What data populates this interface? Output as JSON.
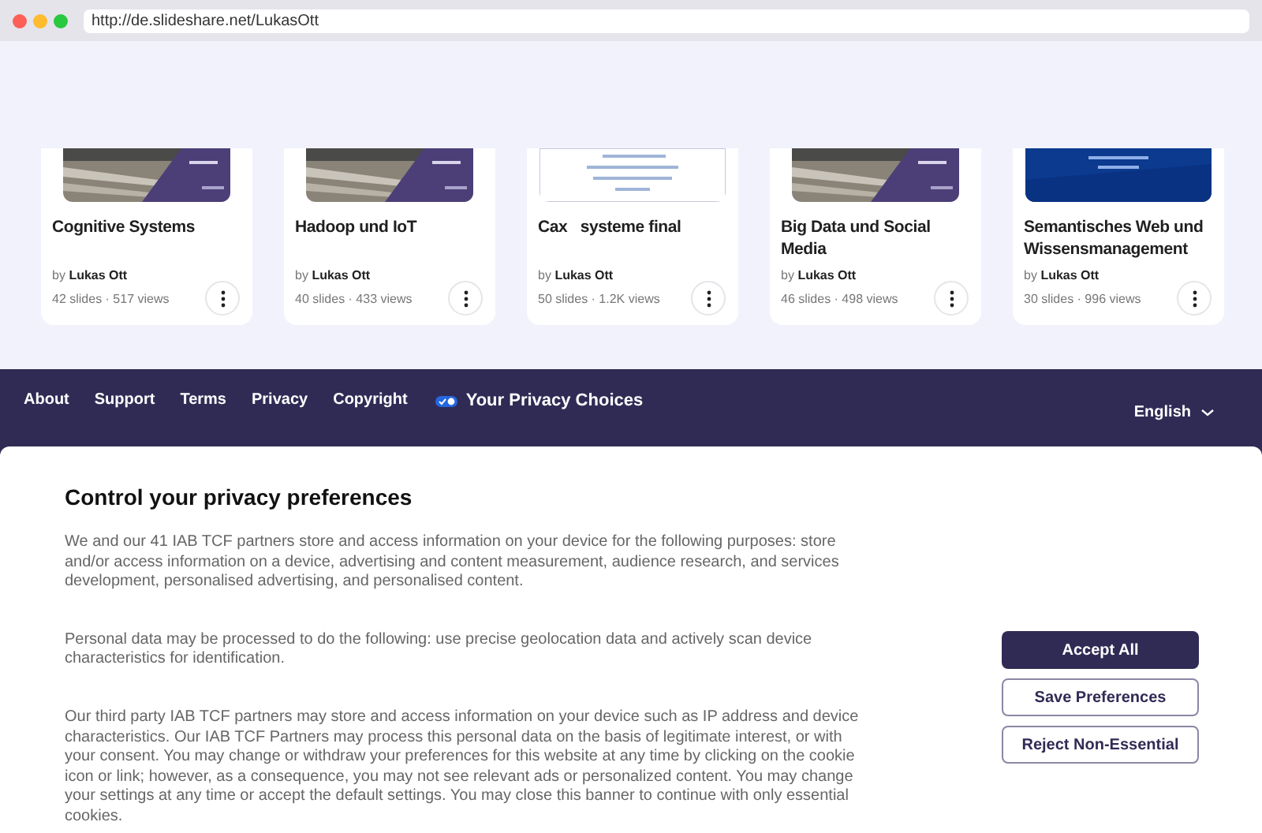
{
  "browser": {
    "url": "http://de.slideshare.net/LukasOtt"
  },
  "cards": [
    {
      "title": "Cognitive Systems",
      "by": "by",
      "author": "Lukas Ott",
      "stats": "42 slides · 517 views"
    },
    {
      "title": "Hadoop und IoT",
      "by": "by",
      "author": "Lukas Ott",
      "stats": "40 slides · 433 views"
    },
    {
      "kind": "document",
      "title": "Cax   systeme final",
      "by": "by",
      "author": "Lukas Ott",
      "stats": "50 slides · 1.2K views"
    },
    {
      "title": "Big Data und Social Media",
      "by": "by",
      "author": "Lukas Ott",
      "stats": "46 slides · 498 views"
    },
    {
      "kind": "blue",
      "title": "Semantisches Web und Wissensmanagement",
      "by": "by",
      "author": "Lukas Ott",
      "stats": "30 slides · 996 views"
    }
  ],
  "footer": {
    "links": [
      "About",
      "Support",
      "Terms",
      "Privacy",
      "Copyright"
    ],
    "privacy_choices": "Your Privacy Choices",
    "language": "English"
  },
  "consent": {
    "title": "Control your privacy preferences",
    "paragraphs": [
      "We and our 41 IAB TCF partners store and access information on your device for the following purposes: store and/or access information on a device, advertising and content measurement, audience research, and services development, personalised advertising, and personalised content.",
      "Personal data may be processed to do the following: use precise geolocation data and actively scan device characteristics for identification.",
      "Our third party IAB TCF partners may store and access information on your device such as IP address and device characteristics. Our IAB TCF Partners may process this personal data on the basis of legitimate interest, or with your consent. You may change or withdraw your preferences for this website at any time by clicking on the cookie icon or link; however, as a consequence, you may not see relevant ads or personalized content. You may change your settings at any time or accept the default settings. You may close this banner to continue with only essential cookies."
    ],
    "buttons": [
      {
        "label": "Accept All",
        "kind": "primary"
      },
      {
        "label": "Save Preferences",
        "kind": "outline"
      },
      {
        "label": "Reject Non-Essential",
        "kind": "outline"
      }
    ]
  }
}
